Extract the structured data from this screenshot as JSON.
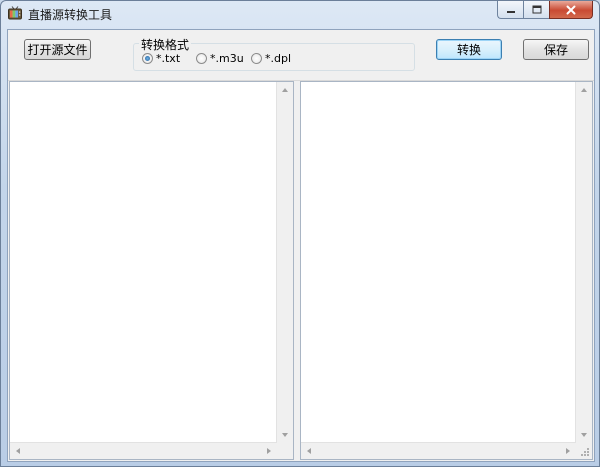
{
  "window": {
    "title": "直播源转换工具",
    "icon": "tv-icon"
  },
  "toolbar": {
    "open_label": "打开源文件",
    "convert_label": "转换",
    "save_label": "保存"
  },
  "format_group": {
    "label": "转换格式",
    "options": [
      {
        "label": "*.txt",
        "selected": true
      },
      {
        "label": "*.m3u",
        "selected": false
      },
      {
        "label": "*.dpl",
        "selected": false
      }
    ]
  },
  "source_text": "",
  "output_text": "",
  "colors": {
    "accent": "#3c7fb1",
    "close_button": "#c94a33",
    "window_frame": "#c3d5ea"
  }
}
